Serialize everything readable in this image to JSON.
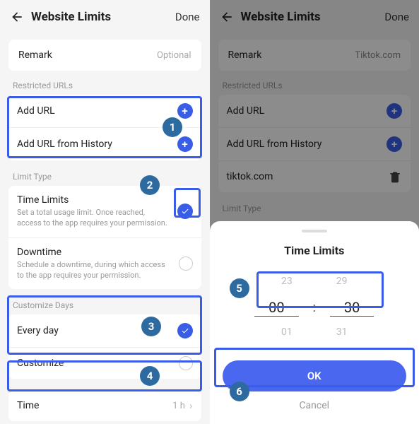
{
  "left": {
    "title": "Website Limits",
    "done": "Done",
    "remark_label": "Remark",
    "remark_placeholder": "Optional",
    "section_urls": "Restricted URLs",
    "add_url": "Add URL",
    "add_url_history": "Add URL from History",
    "section_limit_type": "Limit Type",
    "time_limits_title": "Time Limits",
    "time_limits_sub": "Set a total usage limit. Once reached, access to the app requires your permission.",
    "downtime_title": "Downtime",
    "downtime_sub": "Schedule a downtime, during which access to the app requires your permission.",
    "section_days": "Customize Days",
    "every_day": "Every day",
    "customize": "Customize",
    "time_label": "Time",
    "time_value": "1 h"
  },
  "right": {
    "title": "Website Limits",
    "done": "Done",
    "remark_label": "Remark",
    "remark_value": "Tiktok.com",
    "section_urls": "Restricted URLs",
    "add_url": "Add URL",
    "add_url_history": "Add URL from History",
    "url_entry": "tiktok.com",
    "section_limit_type": "Limit Type",
    "sheet_title": "Time Limits",
    "picker": {
      "prevH": "23",
      "prevM": "29",
      "h": "00",
      "m": "30",
      "nextH": "01",
      "nextM": "31"
    },
    "ok": "OK",
    "cancel": "Cancel"
  },
  "callouts": {
    "n1": "1",
    "n2": "2",
    "n3": "3",
    "n4": "4",
    "n5": "5",
    "n6": "6"
  }
}
